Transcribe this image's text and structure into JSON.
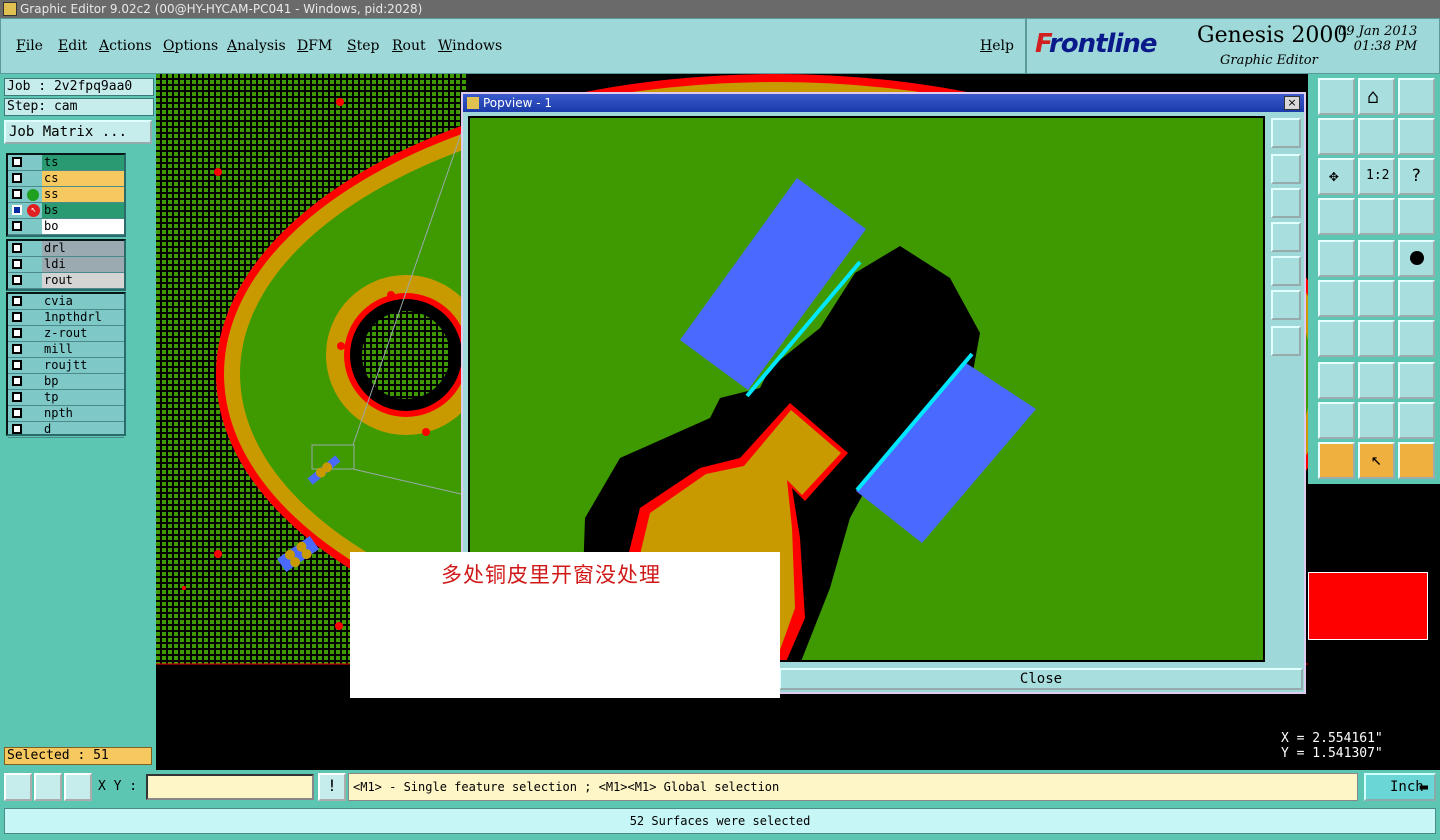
{
  "window": {
    "title": "Graphic Editor 9.02c2 (00@HY-HYCAM-PC041 - Windows, pid:2028)"
  },
  "menu": [
    "File",
    "Edit",
    "Actions",
    "Options",
    "Analysis",
    "DFM",
    "Step",
    "Rout",
    "Windows"
  ],
  "help": "Help",
  "brand": {
    "logo_f": "F",
    "logo_rest": "rontline",
    "product": "Genesis 2000",
    "subtitle": "Graphic Editor",
    "date": "09 Jan 2013",
    "time": "01:38 PM"
  },
  "job": {
    "job_label": "Job : 2v2fpq9aa0",
    "step_label": "Step: cam",
    "matrix_button": "Job Matrix ..."
  },
  "layers": {
    "board": [
      {
        "name": "ts",
        "color": "#2a9a72"
      },
      {
        "name": "cs",
        "color": "#f6c860"
      },
      {
        "name": "ss",
        "color": "#f6c860"
      },
      {
        "name": "bs",
        "color": "#2a9a72"
      },
      {
        "name": "bo",
        "color": "#ffffff"
      }
    ],
    "drill": [
      {
        "name": "drl",
        "color": "#9aaab0"
      },
      {
        "name": "ldi",
        "color": "#9aaab0"
      },
      {
        "name": "rout",
        "color": "#d4d4d4"
      }
    ],
    "misc": [
      {
        "name": "cvia"
      },
      {
        "name": "1npthdrl"
      },
      {
        "name": "z-rout"
      },
      {
        "name": "mill"
      },
      {
        "name": "roujtt"
      },
      {
        "name": "bp"
      },
      {
        "name": "tp"
      },
      {
        "name": "npth"
      },
      {
        "name": "d"
      }
    ]
  },
  "selected": "Selected : 51",
  "popup": {
    "title": "Popview - 1",
    "close_label": "Close",
    "close_icon": "×"
  },
  "annotation": "多处铜皮里开窗没处理",
  "coords": {
    "x": "X = 2.554161\"",
    "y": "Y = 1.541307\""
  },
  "bottom": {
    "xy_label": "X Y :",
    "xy_value": "",
    "alert": "!",
    "message": "<M1> - Single feature selection ; <M1><M1> Global selection",
    "units": "Inch"
  },
  "status": "52 Surfaces were selected",
  "colors": {
    "panel": "#5cc6b2",
    "menu": "#9fd8d8",
    "board": "#3f9a02",
    "copper": "#c89a00",
    "mask": "#ff0000",
    "pad": "#4a6aff",
    "highlight": "#00e8ff"
  }
}
